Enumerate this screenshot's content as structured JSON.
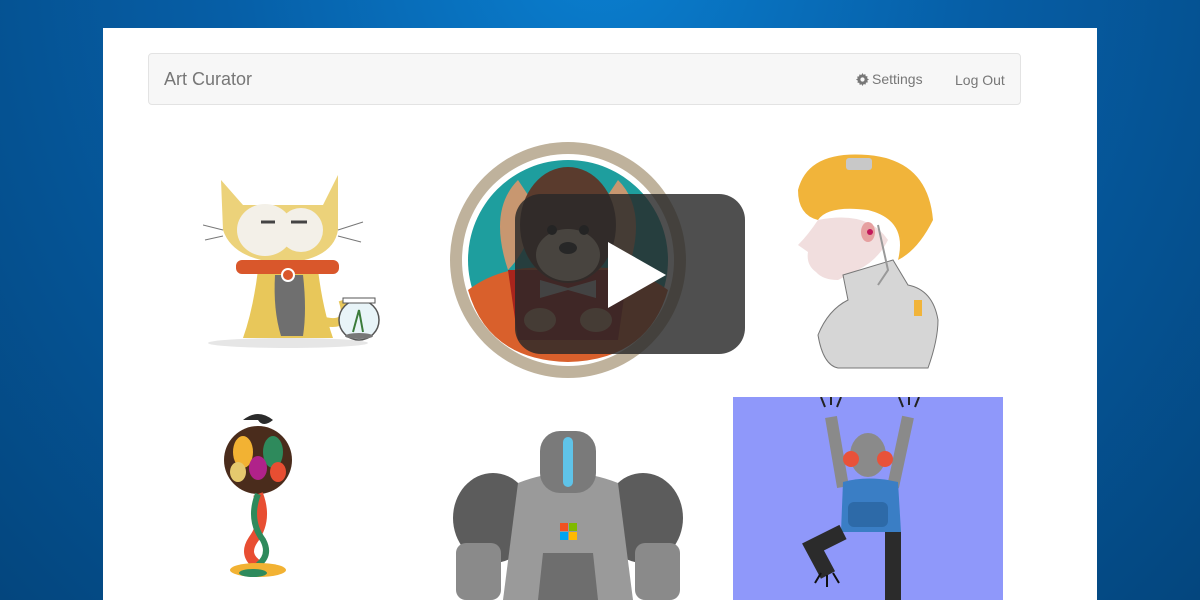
{
  "app": {
    "brand": "Art Curator"
  },
  "nav": {
    "settings_label": "Settings",
    "settings_icon": "gear-icon",
    "logout_label": "Log Out"
  },
  "gallery": {
    "items": [
      {
        "subject": "cat-with-fishbowl"
      },
      {
        "subject": "dog-in-circle"
      },
      {
        "subject": "blonde-cyborg-profile"
      },
      {
        "subject": "abstract-tree"
      },
      {
        "subject": "robot"
      },
      {
        "subject": "climbing-figure",
        "background": "#8f98fa"
      }
    ]
  },
  "video": {
    "icon": "play-icon"
  },
  "colors": {
    "page_background": "#0565ab",
    "card_background": "#ffffff",
    "navbar_background": "#f7f7f7",
    "nav_text": "#777777"
  }
}
